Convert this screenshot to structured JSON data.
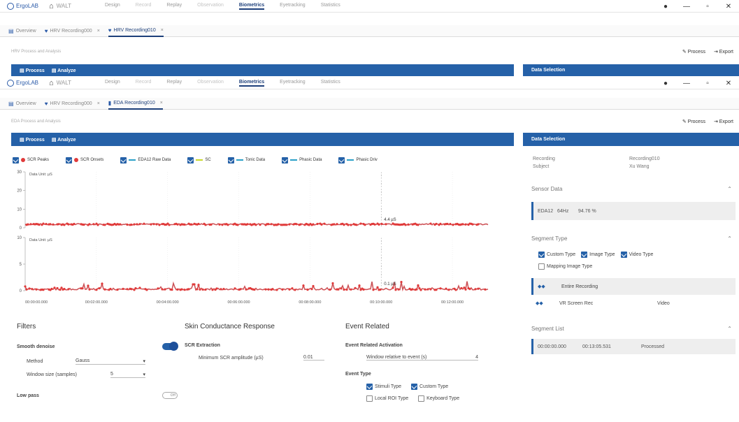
{
  "app": {
    "name": "ErgoLAB",
    "home": "WALT"
  },
  "menu": [
    {
      "label": "Design",
      "state": "normal"
    },
    {
      "label": "Record",
      "state": "dim"
    },
    {
      "label": "Replay",
      "state": "normal"
    },
    {
      "label": "Observation",
      "state": "dim"
    },
    {
      "label": "Biometrics",
      "state": "active"
    },
    {
      "label": "Eyetracking",
      "state": "normal"
    },
    {
      "label": "Statistics",
      "state": "normal"
    }
  ],
  "back_window": {
    "tabs": [
      {
        "label": "Overview",
        "icon": "grid-icon"
      },
      {
        "label": "HRV Recording000",
        "icon": "heart-icon",
        "closable": true
      },
      {
        "label": "HRV Recording010",
        "icon": "heart-icon",
        "closable": true,
        "selected": true
      }
    ],
    "subheader": "HRV Process and Analysis",
    "process_label": "Process",
    "export_label": "Export",
    "bar_process": "Process",
    "bar_analyze": "Analyze",
    "data_selection": "Data Selection"
  },
  "front_window": {
    "tabs": [
      {
        "label": "Overview",
        "icon": "grid-icon"
      },
      {
        "label": "HRV Recording000",
        "icon": "heart-icon",
        "closable": true
      },
      {
        "label": "EDA Recording010",
        "icon": "eda-icon",
        "closable": true,
        "selected": true
      }
    ],
    "subheader": "EDA Process and Analysis",
    "process_label": "Process",
    "export_label": "Export",
    "bar_process": "Process",
    "bar_analyze": "Analyze",
    "data_selection": "Data Selection"
  },
  "legend": [
    {
      "label": "SCR Peaks",
      "kind": "dot",
      "color": "#e03a3a"
    },
    {
      "label": "SCR Onsets",
      "kind": "dot",
      "color": "#e03a3a"
    },
    {
      "label": "EDA12 Raw Data",
      "kind": "line",
      "color": "#2aa0c8"
    },
    {
      "label": "SC",
      "kind": "line",
      "color": "#c8d82a"
    },
    {
      "label": "Tonic Data",
      "kind": "line",
      "color": "#2aa0c8"
    },
    {
      "label": "Phasic Data",
      "kind": "line",
      "color": "#2aa0c8"
    },
    {
      "label": "Phasic Driv",
      "kind": "line",
      "color": "#2aa0c8"
    }
  ],
  "chart_data": [
    {
      "type": "line",
      "ylabel": "Data Unit: µS",
      "y_ticks": [
        "30",
        "20",
        "10",
        "0"
      ],
      "ylim": [
        0,
        30
      ],
      "annotation": "4.4 µS",
      "marker_time": "00:10:00.000"
    },
    {
      "type": "line",
      "ylabel": "Data Unit: µS",
      "y_ticks": [
        "10",
        "5",
        "0"
      ],
      "ylim": [
        0,
        10
      ],
      "annotation": "0.1 µS",
      "marker_time": "00:10:00.000",
      "x_ticks": [
        "00:00:00.000",
        "00:02:00.000",
        "00:04:00.000",
        "00:06:00.000",
        "00:08:00.000",
        "00:10:00.000",
        "00:12:00.000"
      ]
    }
  ],
  "filters": {
    "title": "Filters",
    "smooth_label": "Smooth denoise",
    "smooth_on": true,
    "method_label": "Method",
    "method_value": "Gauss",
    "window_label": "Window size (samples)",
    "window_value": "5",
    "lowpass_label": "Low pass",
    "lowpass_state": "Off"
  },
  "scr": {
    "title": "Skin Conductance Response",
    "extraction_label": "SCR Extraction",
    "min_amp_label": "Minimum SCR amplitude (µS)",
    "min_amp_value": "0.01"
  },
  "event": {
    "title": "Event Related",
    "activation_label": "Event Related Activation",
    "window_label": "Window relative to event (s)",
    "window_value": "4",
    "type_label": "Event Type",
    "types_row1": [
      {
        "label": "Stimuli Type",
        "checked": true
      },
      {
        "label": "Custom Type",
        "checked": true
      }
    ],
    "types_row2": [
      {
        "label": "Local ROI Type",
        "checked": false
      },
      {
        "label": "Keyboard Type",
        "checked": false
      }
    ]
  },
  "right_panel": {
    "recording_label": "Recording",
    "recording_value": "Recording010",
    "subject_label": "Subject",
    "subject_value": "Xu Wang",
    "sensor_title": "Sensor Data",
    "sensor": {
      "name": "EDA12",
      "rate": "64Hz",
      "quality": "94.76 %"
    },
    "segment_title": "Segment Type",
    "segment_types": [
      {
        "label": "Custom Type",
        "checked": true
      },
      {
        "label": "Image Type",
        "checked": true
      },
      {
        "label": "Video Type",
        "checked": true
      }
    ],
    "mapping_label": "Mapping Image Type",
    "segments": [
      {
        "icon": "◆◆",
        "name": "Entire Recording",
        "type": "",
        "selected": true
      },
      {
        "icon": "◆◆",
        "name": "VR Screen Rec",
        "type": "Video",
        "selected": false
      }
    ],
    "list_title": "Segment List",
    "list_row": {
      "start": "00:00:00.000",
      "end": "00:13:05.531",
      "status": "Processed"
    }
  },
  "colors": {
    "accent": "#2561a8",
    "peak": "#e03a3a",
    "raw": "#2aa0c8"
  }
}
